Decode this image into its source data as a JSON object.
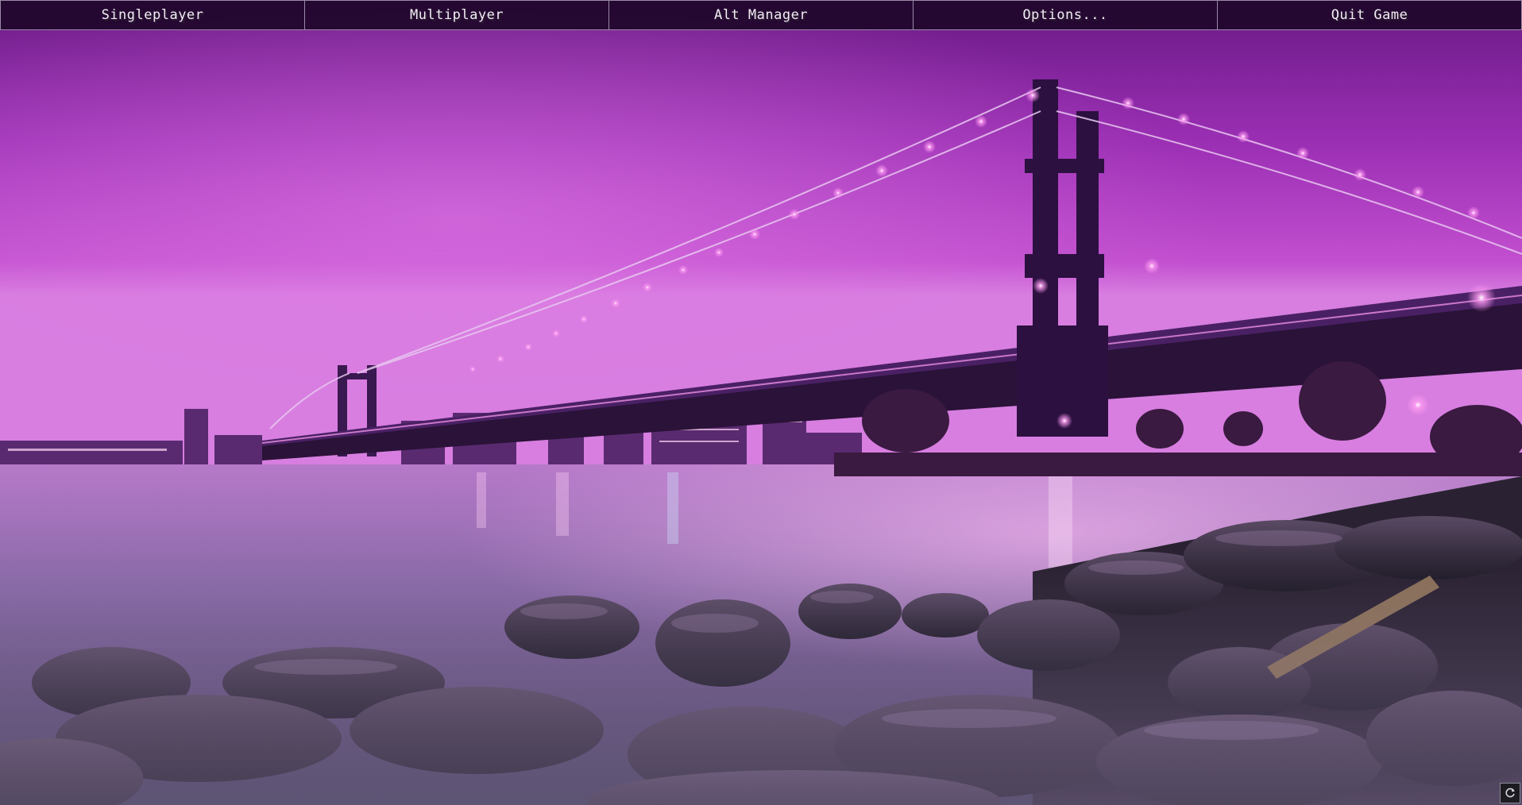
{
  "menu": {
    "singleplayer_label": "Singleplayer",
    "multiplayer_label": "Multiplayer",
    "alt_manager_label": "Alt Manager",
    "options_label": "Options...",
    "quit_label": "Quit Game"
  },
  "background": {
    "scene": "night-bridge-over-river",
    "sky_color": "#b13ec4",
    "accent_color": "#ff7ef0"
  },
  "corner_button": {
    "icon": "refresh-icon"
  }
}
